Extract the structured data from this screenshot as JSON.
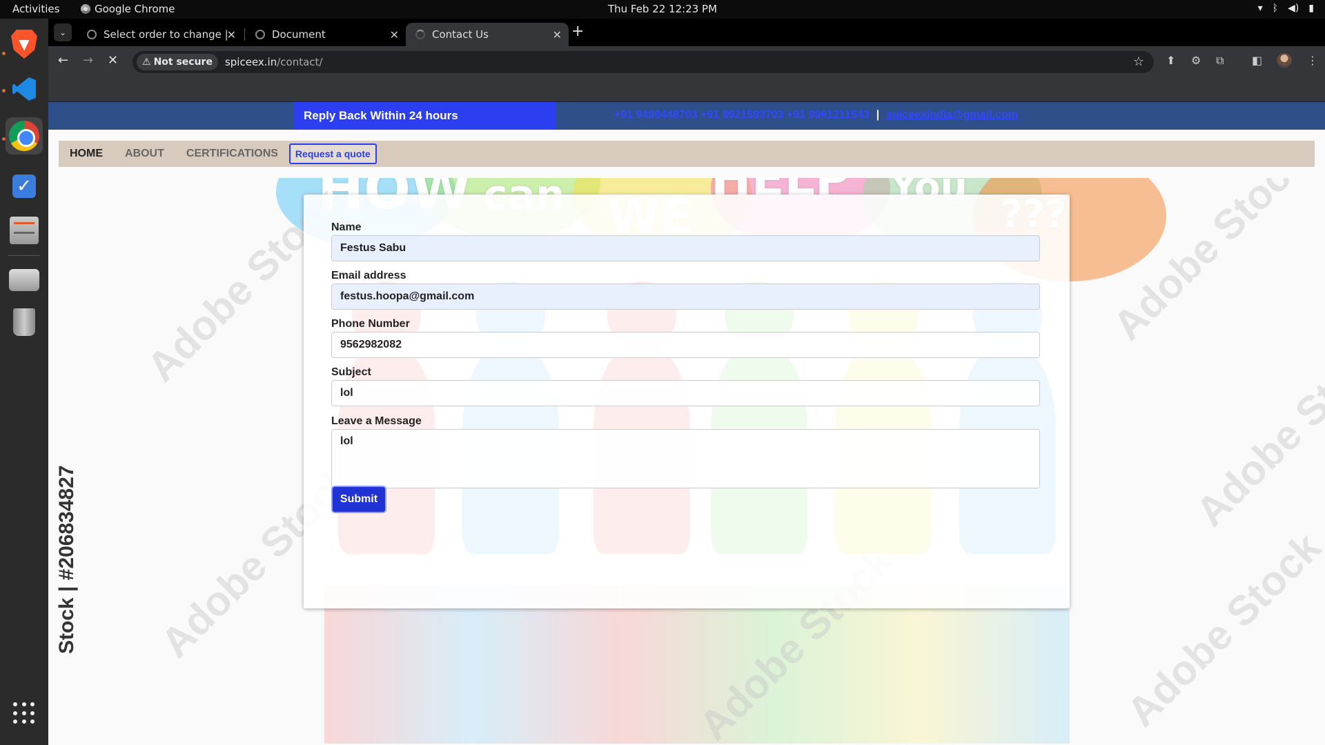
{
  "system": {
    "activities": "Activities",
    "app_name": "Google Chrome",
    "clock": "Thu Feb 22  12:23 PM"
  },
  "dock": {
    "apps": [
      "brave-browser",
      "vscode",
      "google-chrome",
      "tasks",
      "file-cabinet",
      "disk",
      "trash",
      "app-grid"
    ]
  },
  "browser": {
    "tabs": [
      {
        "title": "Select order to change |"
      },
      {
        "title": "Document"
      },
      {
        "title": "Contact Us"
      }
    ],
    "security_label": "Not secure",
    "url_host": "spiceex.in",
    "url_path": "/contact/"
  },
  "site": {
    "reply_banner": "Reply Back Within 24 hours",
    "phones": "+91 9496448703 +91 8921593703 +91 9961211543",
    "separator": "|",
    "email": "spiceexindia@gmail.com",
    "nav": {
      "home": "HOME",
      "about": "ABOUT",
      "certifications": "CERTIFICATIONS",
      "quote": "Request a quote"
    },
    "art": {
      "line1a": "HOW",
      "line1b": "can",
      "line2a": "WE",
      "line2b": "HELP",
      "line2c": "You",
      "qmarks": "???",
      "watermark": "Adobe Stock",
      "stock_id": "Stock | #206834827"
    }
  },
  "form": {
    "name_label": "Name",
    "name_value": "Festus Sabu",
    "email_label": "Email address",
    "email_value": "festus.hoopa@gmail.com",
    "phone_label": "Phone Number",
    "phone_value": "9562982082",
    "subject_label": "Subject",
    "subject_value": "lol",
    "message_label": "Leave a Message",
    "message_value": "lol",
    "submit_label": "Submit"
  },
  "colors": {
    "accent_blue": "#2c3ff0",
    "nav_bg": "#d8cbbd",
    "contact_bar_bg": "#2f4f8a"
  }
}
